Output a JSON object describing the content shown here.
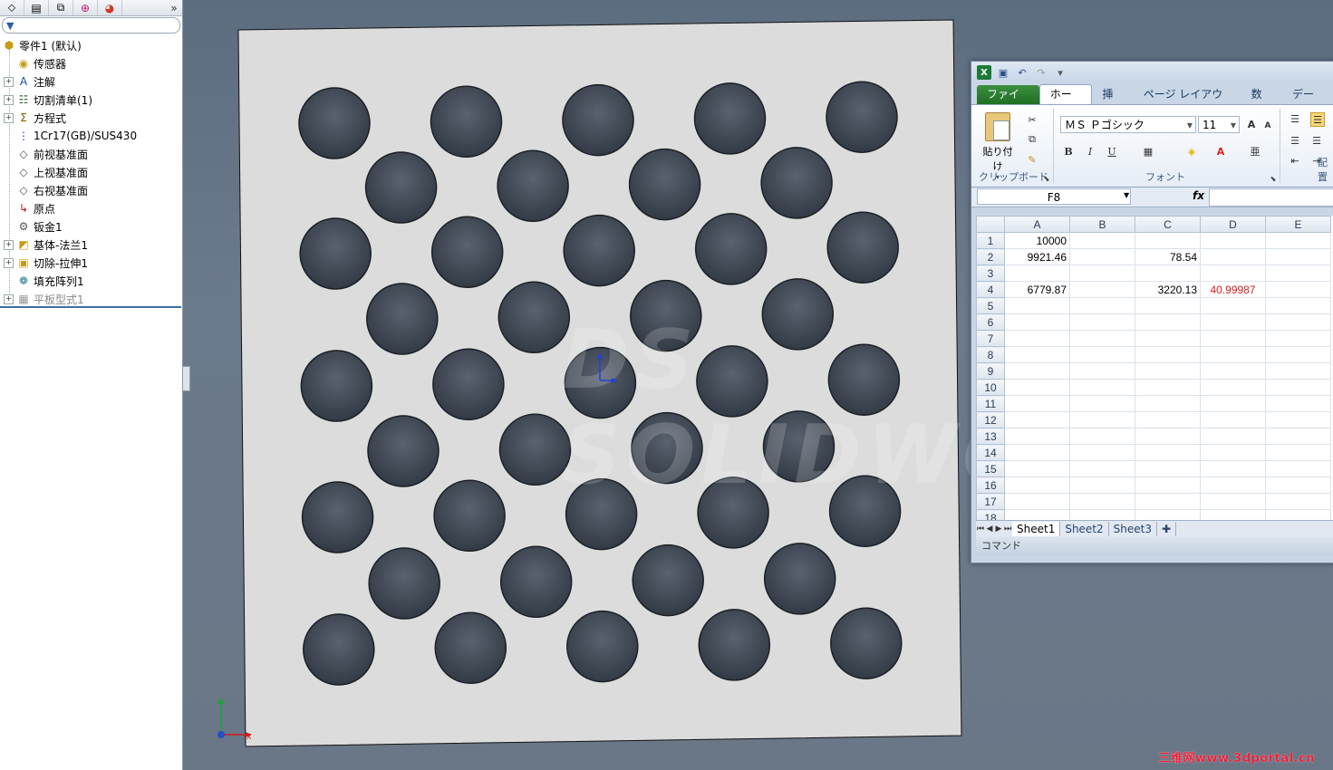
{
  "feature_tree": {
    "toolbar_icons": [
      "feature-manager-icon",
      "property-manager-icon",
      "configuration-manager-icon",
      "dimxpert-icon",
      "display-manager-icon"
    ],
    "more_label": "»",
    "items": [
      {
        "label": "零件1 (默认)",
        "icon": "part-icon",
        "expander": ""
      },
      {
        "label": "传感器",
        "icon": "sensor-icon",
        "expander": ""
      },
      {
        "label": "注解",
        "icon": "annotation-icon",
        "expander": "+"
      },
      {
        "label": "切割清单(1)",
        "icon": "cut-list-icon",
        "expander": "+"
      },
      {
        "label": "方程式",
        "icon": "equation-icon",
        "expander": "+"
      },
      {
        "label": "1Cr17(GB)/SUS430",
        "icon": "material-icon",
        "expander": ""
      },
      {
        "label": "前视基准面",
        "icon": "plane-icon",
        "expander": ""
      },
      {
        "label": "上视基准面",
        "icon": "plane-icon",
        "expander": ""
      },
      {
        "label": "右视基准面",
        "icon": "plane-icon",
        "expander": ""
      },
      {
        "label": "原点",
        "icon": "origin-icon",
        "expander": ""
      },
      {
        "label": "钣金1",
        "icon": "sheet-metal-icon",
        "expander": ""
      },
      {
        "label": "基体-法兰1",
        "icon": "base-flange-icon",
        "expander": "+"
      },
      {
        "label": "切除-拉伸1",
        "icon": "cut-extrude-icon",
        "expander": "+"
      },
      {
        "label": "填充阵列1",
        "icon": "fill-pattern-icon",
        "expander": ""
      },
      {
        "label": "平板型式1",
        "icon": "flat-pattern-icon",
        "expander": "+"
      }
    ]
  },
  "viewport": {
    "watermark": "DS SOLIDWORKS",
    "triad_labels": {
      "x": "X",
      "y": "Y"
    }
  },
  "excel": {
    "tabs": [
      "ファイル",
      "ホーム",
      "挿入",
      "ページ レイアウト",
      "数式",
      "データ"
    ],
    "active_tab": "ホーム",
    "ribbon": {
      "paste_label": "貼り付け",
      "clipboard_group": "クリップボード",
      "font_group": "フォント",
      "align_group": "配置",
      "font_name": "ＭＳ Ｐゴシック",
      "font_size": "11",
      "bold": "B",
      "italic": "I",
      "underline": "U"
    },
    "name_box": "F8",
    "fx_label": "fx",
    "formula": "",
    "columns": [
      "A",
      "B",
      "C",
      "D",
      "E"
    ],
    "rows": [
      {
        "n": "1",
        "A": "10000",
        "B": "",
        "C": "",
        "D": "",
        "E": ""
      },
      {
        "n": "2",
        "A": "9921.46",
        "B": "",
        "C": "78.54",
        "D": "",
        "E": ""
      },
      {
        "n": "3",
        "A": "",
        "B": "",
        "C": "",
        "D": "",
        "E": ""
      },
      {
        "n": "4",
        "A": "6779.87",
        "B": "",
        "C": "3220.13",
        "D": "40.99987",
        "E": ""
      },
      {
        "n": "5",
        "A": "",
        "B": "",
        "C": "",
        "D": "",
        "E": ""
      },
      {
        "n": "6",
        "A": "",
        "B": "",
        "C": "",
        "D": "",
        "E": ""
      },
      {
        "n": "7",
        "A": "",
        "B": "",
        "C": "",
        "D": "",
        "E": ""
      },
      {
        "n": "8",
        "A": "",
        "B": "",
        "C": "",
        "D": "",
        "E": ""
      },
      {
        "n": "9",
        "A": "",
        "B": "",
        "C": "",
        "D": "",
        "E": ""
      },
      {
        "n": "10",
        "A": "",
        "B": "",
        "C": "",
        "D": "",
        "E": ""
      },
      {
        "n": "11",
        "A": "",
        "B": "",
        "C": "",
        "D": "",
        "E": ""
      },
      {
        "n": "12",
        "A": "",
        "B": "",
        "C": "",
        "D": "",
        "E": ""
      },
      {
        "n": "13",
        "A": "",
        "B": "",
        "C": "",
        "D": "",
        "E": ""
      },
      {
        "n": "14",
        "A": "",
        "B": "",
        "C": "",
        "D": "",
        "E": ""
      },
      {
        "n": "15",
        "A": "",
        "B": "",
        "C": "",
        "D": "",
        "E": ""
      },
      {
        "n": "16",
        "A": "",
        "B": "",
        "C": "",
        "D": "",
        "E": ""
      },
      {
        "n": "17",
        "A": "",
        "B": "",
        "C": "",
        "D": "",
        "E": ""
      },
      {
        "n": "18",
        "A": "",
        "B": "",
        "C": "",
        "D": "",
        "E": ""
      }
    ],
    "sheet_tabs": [
      "Sheet1",
      "Sheet2",
      "Sheet3"
    ],
    "active_sheet": "Sheet1",
    "status": "コマンド",
    "highlight_color": "#d42020"
  },
  "footer_watermark": "三维网www.3dportal.cn",
  "colors": {
    "plate": "#dcdcdc",
    "hole": "#3f4854",
    "background": "#646f7d",
    "excel_accent": "#1f6e24"
  }
}
